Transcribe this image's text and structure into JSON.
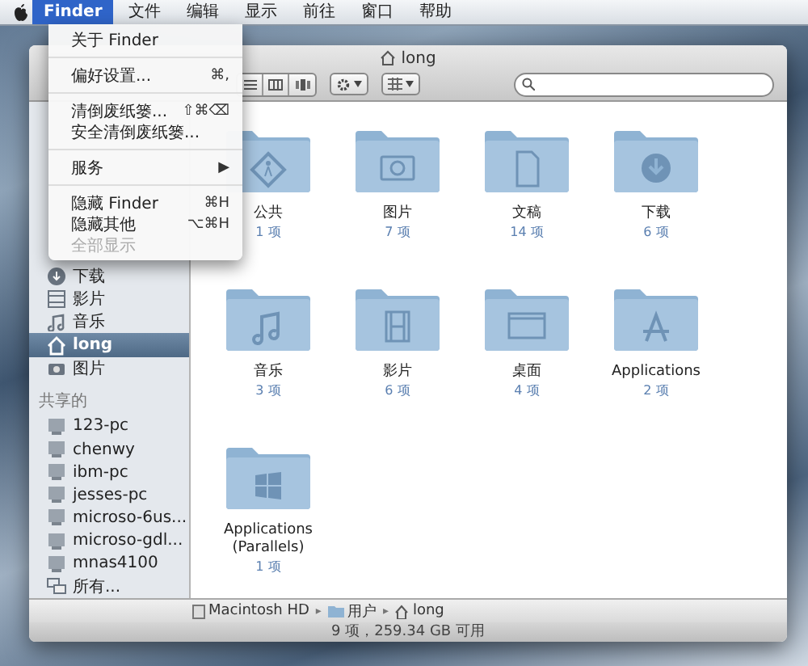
{
  "menubar": {
    "items": [
      {
        "label": "Finder",
        "selected": true
      },
      {
        "label": "文件",
        "selected": false
      },
      {
        "label": "编辑",
        "selected": false
      },
      {
        "label": "显示",
        "selected": false
      },
      {
        "label": "前往",
        "selected": false
      },
      {
        "label": "窗口",
        "selected": false
      },
      {
        "label": "帮助",
        "selected": false
      }
    ]
  },
  "menu": {
    "items": [
      {
        "kind": "item",
        "label": "关于 Finder",
        "disabled": false
      },
      {
        "kind": "separator"
      },
      {
        "kind": "item",
        "label": "偏好设置...",
        "shortcut": "⌘,",
        "disabled": false
      },
      {
        "kind": "separator"
      },
      {
        "kind": "item",
        "label": "清倒废纸篓...",
        "shortcut": "⇧⌘⌫",
        "disabled": false
      },
      {
        "kind": "item",
        "label": "安全清倒废纸篓...",
        "disabled": false
      },
      {
        "kind": "separator"
      },
      {
        "kind": "item",
        "label": "服务",
        "shortcut": "▶",
        "disabled": false
      },
      {
        "kind": "separator"
      },
      {
        "kind": "item",
        "label": "隐藏 Finder",
        "shortcut": "⌘H",
        "disabled": false
      },
      {
        "kind": "item",
        "label": "隐藏其他",
        "shortcut": "⌥⌘H",
        "disabled": false
      },
      {
        "kind": "item",
        "label": "全部显示",
        "disabled": true
      }
    ]
  },
  "window": {
    "title": "long"
  },
  "sidebar": {
    "items": [
      {
        "kind": "downloads",
        "label": "下载",
        "selected": false
      },
      {
        "kind": "movies",
        "label": "影片",
        "selected": false
      },
      {
        "kind": "music",
        "label": "音乐",
        "selected": false
      },
      {
        "kind": "home",
        "label": "long",
        "selected": true
      },
      {
        "kind": "pictures",
        "label": "图片",
        "selected": false
      }
    ],
    "shared_header": "共享的",
    "shared": [
      {
        "kind": "computer",
        "label": "123-pc"
      },
      {
        "kind": "computer",
        "label": "chenwy"
      },
      {
        "kind": "computer",
        "label": "ibm-pc"
      },
      {
        "kind": "computer",
        "label": "jesses-pc"
      },
      {
        "kind": "computer",
        "label": "microso-6us..."
      },
      {
        "kind": "computer",
        "label": "microso-gdl..."
      },
      {
        "kind": "computer",
        "label": "mnas4100"
      },
      {
        "kind": "network",
        "label": "所有..."
      }
    ]
  },
  "folders": [
    {
      "kind": "public",
      "name": "公共",
      "count": "1 项"
    },
    {
      "kind": "pictures",
      "name": "图片",
      "count": "7 项"
    },
    {
      "kind": "documents",
      "name": "文稿",
      "count": "14 项"
    },
    {
      "kind": "downloads",
      "name": "下载",
      "count": "6 项"
    },
    {
      "kind": "music",
      "name": "音乐",
      "count": "3 项"
    },
    {
      "kind": "movies",
      "name": "影片",
      "count": "6 项"
    },
    {
      "kind": "desktop",
      "name": "桌面",
      "count": "4 项"
    },
    {
      "kind": "applications",
      "name": "Applications",
      "count": "2 项"
    },
    {
      "kind": "windows",
      "name": "Applications (Parallels)",
      "count": "1 项"
    }
  ],
  "path_bar": [
    "Macintosh HD",
    "用户",
    "long"
  ],
  "path_separator": "▸",
  "status_bar": "9 项，259.34 GB 可用"
}
